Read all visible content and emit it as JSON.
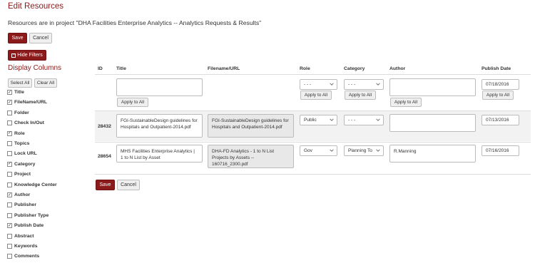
{
  "header": {
    "title": "Edit Resources",
    "project_line": "Resources are in project \"DHA Facilities Enterprise Analytics -- Analytics Requests & Results\""
  },
  "actions": {
    "save": "Save",
    "cancel": "Cancel"
  },
  "filters": {
    "hide_label": "Hide Filters"
  },
  "display_columns": {
    "heading": "Display Columns",
    "select_all": "Select All",
    "clear_all": "Clear All",
    "items": [
      {
        "label": "Title",
        "checked": true
      },
      {
        "label": "FileName/URL",
        "checked": true
      },
      {
        "label": "Folder",
        "checked": false
      },
      {
        "label": "Check In/Out",
        "checked": false
      },
      {
        "label": "Role",
        "checked": true
      },
      {
        "label": "Topics",
        "checked": false
      },
      {
        "label": "Lock URL",
        "checked": false
      },
      {
        "label": "Category",
        "checked": true
      },
      {
        "label": "Project",
        "checked": false
      },
      {
        "label": "Knowledge Center",
        "checked": false
      },
      {
        "label": "Author",
        "checked": true
      },
      {
        "label": "Publisher",
        "checked": false
      },
      {
        "label": "Publisher Type",
        "checked": false
      },
      {
        "label": "Publish Date",
        "checked": true
      },
      {
        "label": "Abstract",
        "checked": false
      },
      {
        "label": "Keywords",
        "checked": false
      },
      {
        "label": "Comments",
        "checked": false
      }
    ]
  },
  "table": {
    "columns": [
      "ID",
      "Title",
      "Filename/URL",
      "Role",
      "Category",
      "Author",
      "Publish Date"
    ],
    "bulk": {
      "role": "- - -",
      "category": "- - -",
      "publish_date": "07/18/2016",
      "apply_label": "Apply to All"
    },
    "rows": [
      {
        "id": "28432",
        "title": "FGI-SustainableDesign guidelines for Hospitals and Outpatient-2014.pdf",
        "filename": "FGI-SustainableDesign guidelines for Hospitals and Outpatient-2014.pdf",
        "role": "Public",
        "category": "- - -",
        "author": "",
        "publish_date": "07/13/2016"
      },
      {
        "id": "28654",
        "title": "MHS Facilities Enterprise Analytics | 1 to N List by Asset",
        "filename": "DHA-FD Analytics - 1 to N List Projects by Assets -- 160716_2300.pdf",
        "role": "Gov",
        "category": "Planning To",
        "author": "R.Manning",
        "publish_date": "07/16/2016"
      }
    ]
  }
}
